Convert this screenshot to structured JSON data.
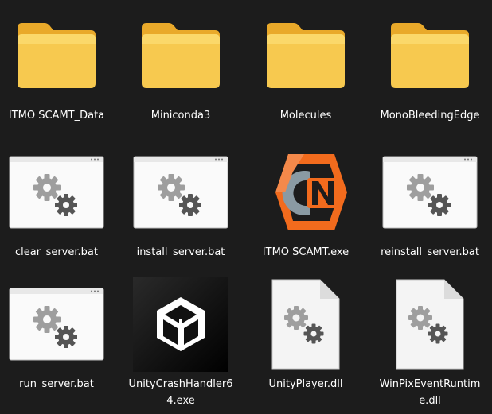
{
  "explorer": {
    "items": [
      {
        "label": "ITMO SCAMT_Data",
        "type": "folder"
      },
      {
        "label": "Miniconda3",
        "type": "folder"
      },
      {
        "label": "Molecules",
        "type": "folder"
      },
      {
        "label": "MonoBleedingEdge",
        "type": "folder"
      },
      {
        "label": "clear_server.bat",
        "type": "batch"
      },
      {
        "label": "install_server.bat",
        "type": "batch"
      },
      {
        "label": "ITMO SCAMT.exe",
        "type": "app-exe"
      },
      {
        "label": "reinstall_server.bat",
        "type": "batch"
      },
      {
        "label": "run_server.bat",
        "type": "batch"
      },
      {
        "label": "UnityCrashHandler64.exe",
        "type": "unity-exe"
      },
      {
        "label": "UnityPlayer.dll",
        "type": "dll"
      },
      {
        "label": "WinPixEventRuntime.dll",
        "type": "dll"
      }
    ]
  },
  "icons": {
    "folder": "folder-icon",
    "batch": "batch-file-icon",
    "app-exe": "itmo-scamt-app-icon",
    "unity-exe": "unity-logo-icon",
    "dll": "dll-file-icon"
  },
  "colors": {
    "background": "#1c1c1c",
    "folder_yellow": "#f6c64f",
    "app_orange": "#f26b1d",
    "text": "#ffffff"
  }
}
